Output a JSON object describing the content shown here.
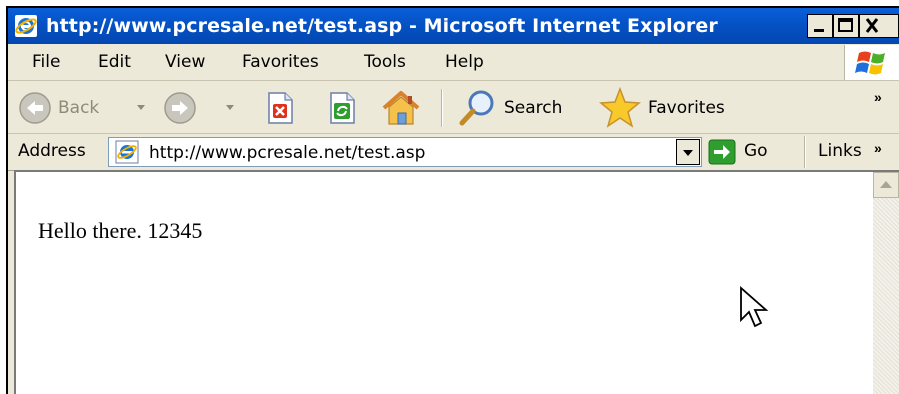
{
  "window": {
    "title": "http://www.pcresale.net/test.asp - Microsoft Internet Explorer"
  },
  "menu": {
    "items": [
      {
        "label": "File"
      },
      {
        "label": "Edit"
      },
      {
        "label": "View"
      },
      {
        "label": "Favorites"
      },
      {
        "label": "Tools"
      },
      {
        "label": "Help"
      }
    ]
  },
  "toolbar": {
    "back_label": "Back",
    "search_label": "Search",
    "favorites_label": "Favorites",
    "overflow": "»"
  },
  "address": {
    "label": "Address",
    "url": "http://www.pcresale.net/test.asp",
    "go_label": "Go",
    "links_label": "Links",
    "links_overflow": "»"
  },
  "page": {
    "text": "Hello there. 12345"
  },
  "colors": {
    "titlebar": "#0553c7",
    "chrome": "#ece9d8",
    "go_green": "#2e9e2e"
  }
}
